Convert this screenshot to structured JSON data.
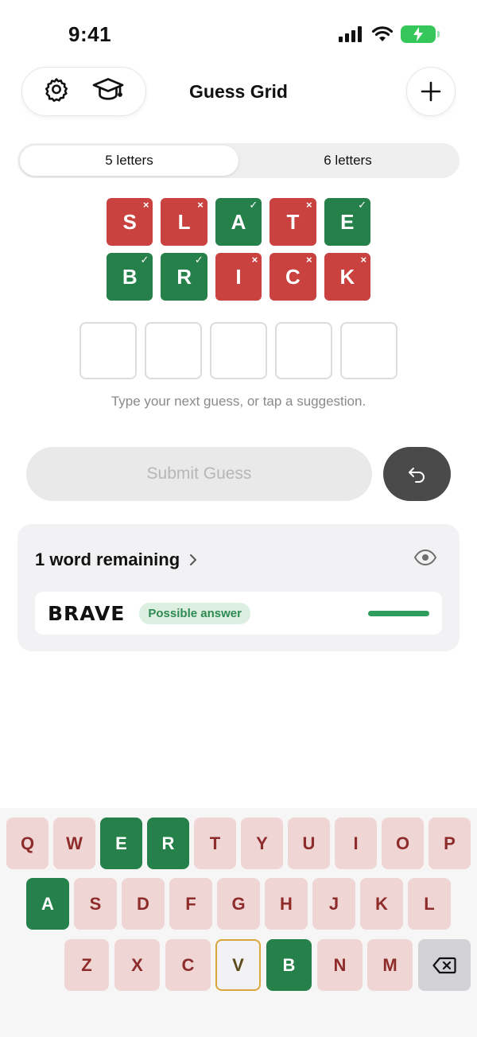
{
  "status": {
    "time": "9:41"
  },
  "header": {
    "title": "Guess Grid",
    "settings_icon": "gear-icon",
    "learn_icon": "graduation-cap-icon",
    "add_icon": "plus-icon"
  },
  "segmented": {
    "options": [
      "5 letters",
      "6 letters"
    ],
    "selected": "5 letters"
  },
  "guesses": [
    {
      "word": "SLATE",
      "letters": [
        {
          "ch": "S",
          "state": "absent",
          "mark": "×"
        },
        {
          "ch": "L",
          "state": "absent",
          "mark": "×"
        },
        {
          "ch": "A",
          "state": "correct",
          "mark": "✓"
        },
        {
          "ch": "T",
          "state": "absent",
          "mark": "×"
        },
        {
          "ch": "E",
          "state": "correct",
          "mark": "✓"
        }
      ]
    },
    {
      "word": "BRICK",
      "letters": [
        {
          "ch": "B",
          "state": "correct",
          "mark": "✓"
        },
        {
          "ch": "R",
          "state": "correct",
          "mark": "✓"
        },
        {
          "ch": "I",
          "state": "absent",
          "mark": "×"
        },
        {
          "ch": "C",
          "state": "absent",
          "mark": "×"
        },
        {
          "ch": "K",
          "state": "absent",
          "mark": "×"
        }
      ]
    }
  ],
  "hint": "Type your next guess, or tap a suggestion.",
  "submit_label": "Submit Guess",
  "remaining": {
    "title": "1 word remaining",
    "words": [
      {
        "word": "BRAVE",
        "badge": "Possible answer",
        "score": 1.0
      }
    ]
  },
  "keyboard": {
    "rows": [
      [
        "Q",
        "W",
        "E",
        "R",
        "T",
        "Y",
        "U",
        "I",
        "O",
        "P"
      ],
      [
        "A",
        "S",
        "D",
        "F",
        "G",
        "H",
        "J",
        "K",
        "L"
      ],
      [
        "Z",
        "X",
        "C",
        "V",
        "B",
        "N",
        "M"
      ]
    ],
    "green": [
      "E",
      "R",
      "A",
      "B"
    ],
    "yellow": [
      "V"
    ]
  },
  "colors": {
    "absent": "#c9423f",
    "correct": "#26804a",
    "accent_green": "#2f9d5d"
  }
}
